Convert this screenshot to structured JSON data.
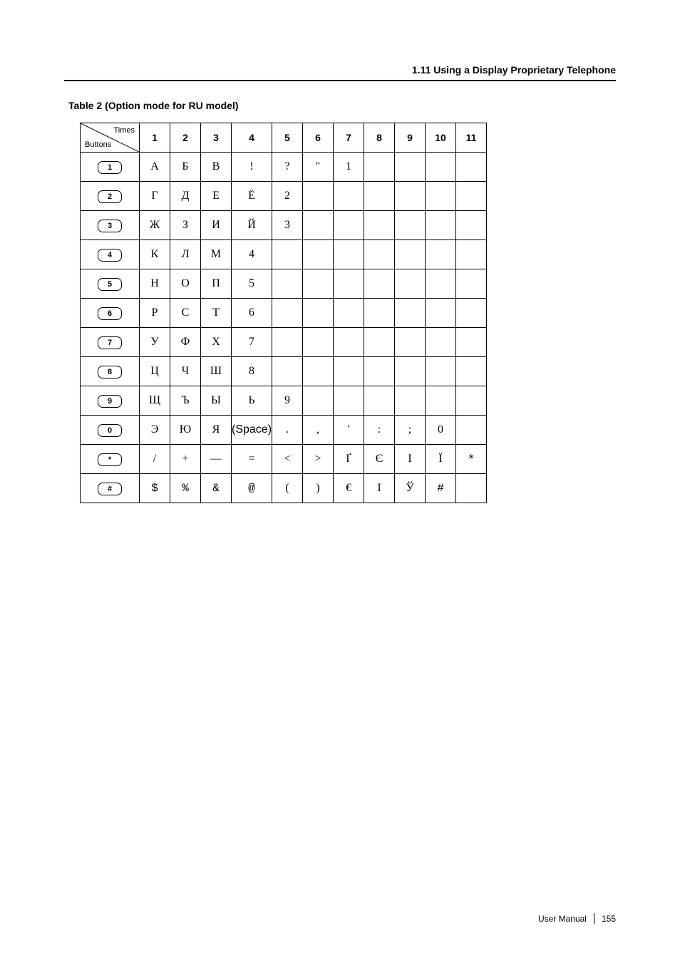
{
  "header": {
    "section": "1.11 Using a Display Proprietary Telephone"
  },
  "table_title": "Table 2 (Option mode for RU model)",
  "diag": {
    "top_right": "Times",
    "bottom_left": "Buttons"
  },
  "columns": [
    "1",
    "2",
    "3",
    "4",
    "5",
    "6",
    "7",
    "8",
    "9",
    "10",
    "11"
  ],
  "buttons": [
    "1",
    "2",
    "3",
    "4",
    "5",
    "6",
    "7",
    "8",
    "9",
    "0",
    "*",
    "#"
  ],
  "rows": [
    [
      "А",
      "Б",
      "В",
      "!",
      "?",
      "\"",
      "1",
      "",
      "",
      "",
      ""
    ],
    [
      "Г",
      "Д",
      "Е",
      "Ё",
      "2",
      "",
      "",
      "",
      "",
      "",
      ""
    ],
    [
      "Ж",
      "З",
      "И",
      "Й",
      "3",
      "",
      "",
      "",
      "",
      "",
      ""
    ],
    [
      "К",
      "Л",
      "М",
      "4",
      "",
      "",
      "",
      "",
      "",
      "",
      ""
    ],
    [
      "Н",
      "О",
      "П",
      "5",
      "",
      "",
      "",
      "",
      "",
      "",
      ""
    ],
    [
      "Р",
      "С",
      "Т",
      "6",
      "",
      "",
      "",
      "",
      "",
      "",
      ""
    ],
    [
      "У",
      "Ф",
      "Х",
      "7",
      "",
      "",
      "",
      "",
      "",
      "",
      ""
    ],
    [
      "Ц",
      "Ч",
      "Ш",
      "8",
      "",
      "",
      "",
      "",
      "",
      "",
      ""
    ],
    [
      "Щ",
      "Ъ",
      "Ы",
      "Ь",
      "9",
      "",
      "",
      "",
      "",
      "",
      ""
    ],
    [
      "Э",
      "Ю",
      "Я",
      "(Space)",
      ".",
      ",",
      "'",
      ":",
      ";",
      "0",
      ""
    ],
    [
      "/",
      "+",
      "—",
      "=",
      "<",
      ">",
      "Ґ",
      "Є",
      "І",
      "Ї",
      "*"
    ],
    [
      "$",
      "%",
      "&",
      "@",
      "(",
      ")",
      "€",
      "І",
      "Ў",
      "#",
      ""
    ]
  ],
  "footer": {
    "label": "User Manual",
    "page": "155"
  },
  "chart_data": {
    "type": "table",
    "title": "Table 2 (Option mode for RU model)",
    "column_headers": [
      "Times 1",
      "Times 2",
      "Times 3",
      "Times 4",
      "Times 5",
      "Times 6",
      "Times 7",
      "Times 8",
      "Times 9",
      "Times 10",
      "Times 11"
    ],
    "row_headers": [
      "Button 1",
      "Button 2",
      "Button 3",
      "Button 4",
      "Button 5",
      "Button 6",
      "Button 7",
      "Button 8",
      "Button 9",
      "Button 0",
      "Button *",
      "Button #"
    ],
    "data": [
      [
        "А",
        "Б",
        "В",
        "!",
        "?",
        "\"",
        "1",
        "",
        "",
        "",
        ""
      ],
      [
        "Г",
        "Д",
        "Е",
        "Ё",
        "2",
        "",
        "",
        "",
        "",
        "",
        ""
      ],
      [
        "Ж",
        "З",
        "И",
        "Й",
        "3",
        "",
        "",
        "",
        "",
        "",
        ""
      ],
      [
        "К",
        "Л",
        "М",
        "4",
        "",
        "",
        "",
        "",
        "",
        "",
        ""
      ],
      [
        "Н",
        "О",
        "П",
        "5",
        "",
        "",
        "",
        "",
        "",
        "",
        ""
      ],
      [
        "Р",
        "С",
        "Т",
        "6",
        "",
        "",
        "",
        "",
        "",
        "",
        ""
      ],
      [
        "У",
        "Ф",
        "Х",
        "7",
        "",
        "",
        "",
        "",
        "",
        "",
        ""
      ],
      [
        "Ц",
        "Ч",
        "Ш",
        "8",
        "",
        "",
        "",
        "",
        "",
        "",
        ""
      ],
      [
        "Щ",
        "Ъ",
        "Ы",
        "Ь",
        "9",
        "",
        "",
        "",
        "",
        "",
        ""
      ],
      [
        "Э",
        "Ю",
        "Я",
        "(Space)",
        ".",
        ",",
        "'",
        ":",
        ";",
        "0",
        ""
      ],
      [
        "/",
        "+",
        "—",
        "=",
        "<",
        ">",
        "Ґ",
        "Є",
        "І",
        "Ї",
        "*"
      ],
      [
        "$",
        "%",
        "&",
        "@",
        "(",
        ")",
        "€",
        "І",
        "Ў",
        "#",
        ""
      ]
    ]
  }
}
